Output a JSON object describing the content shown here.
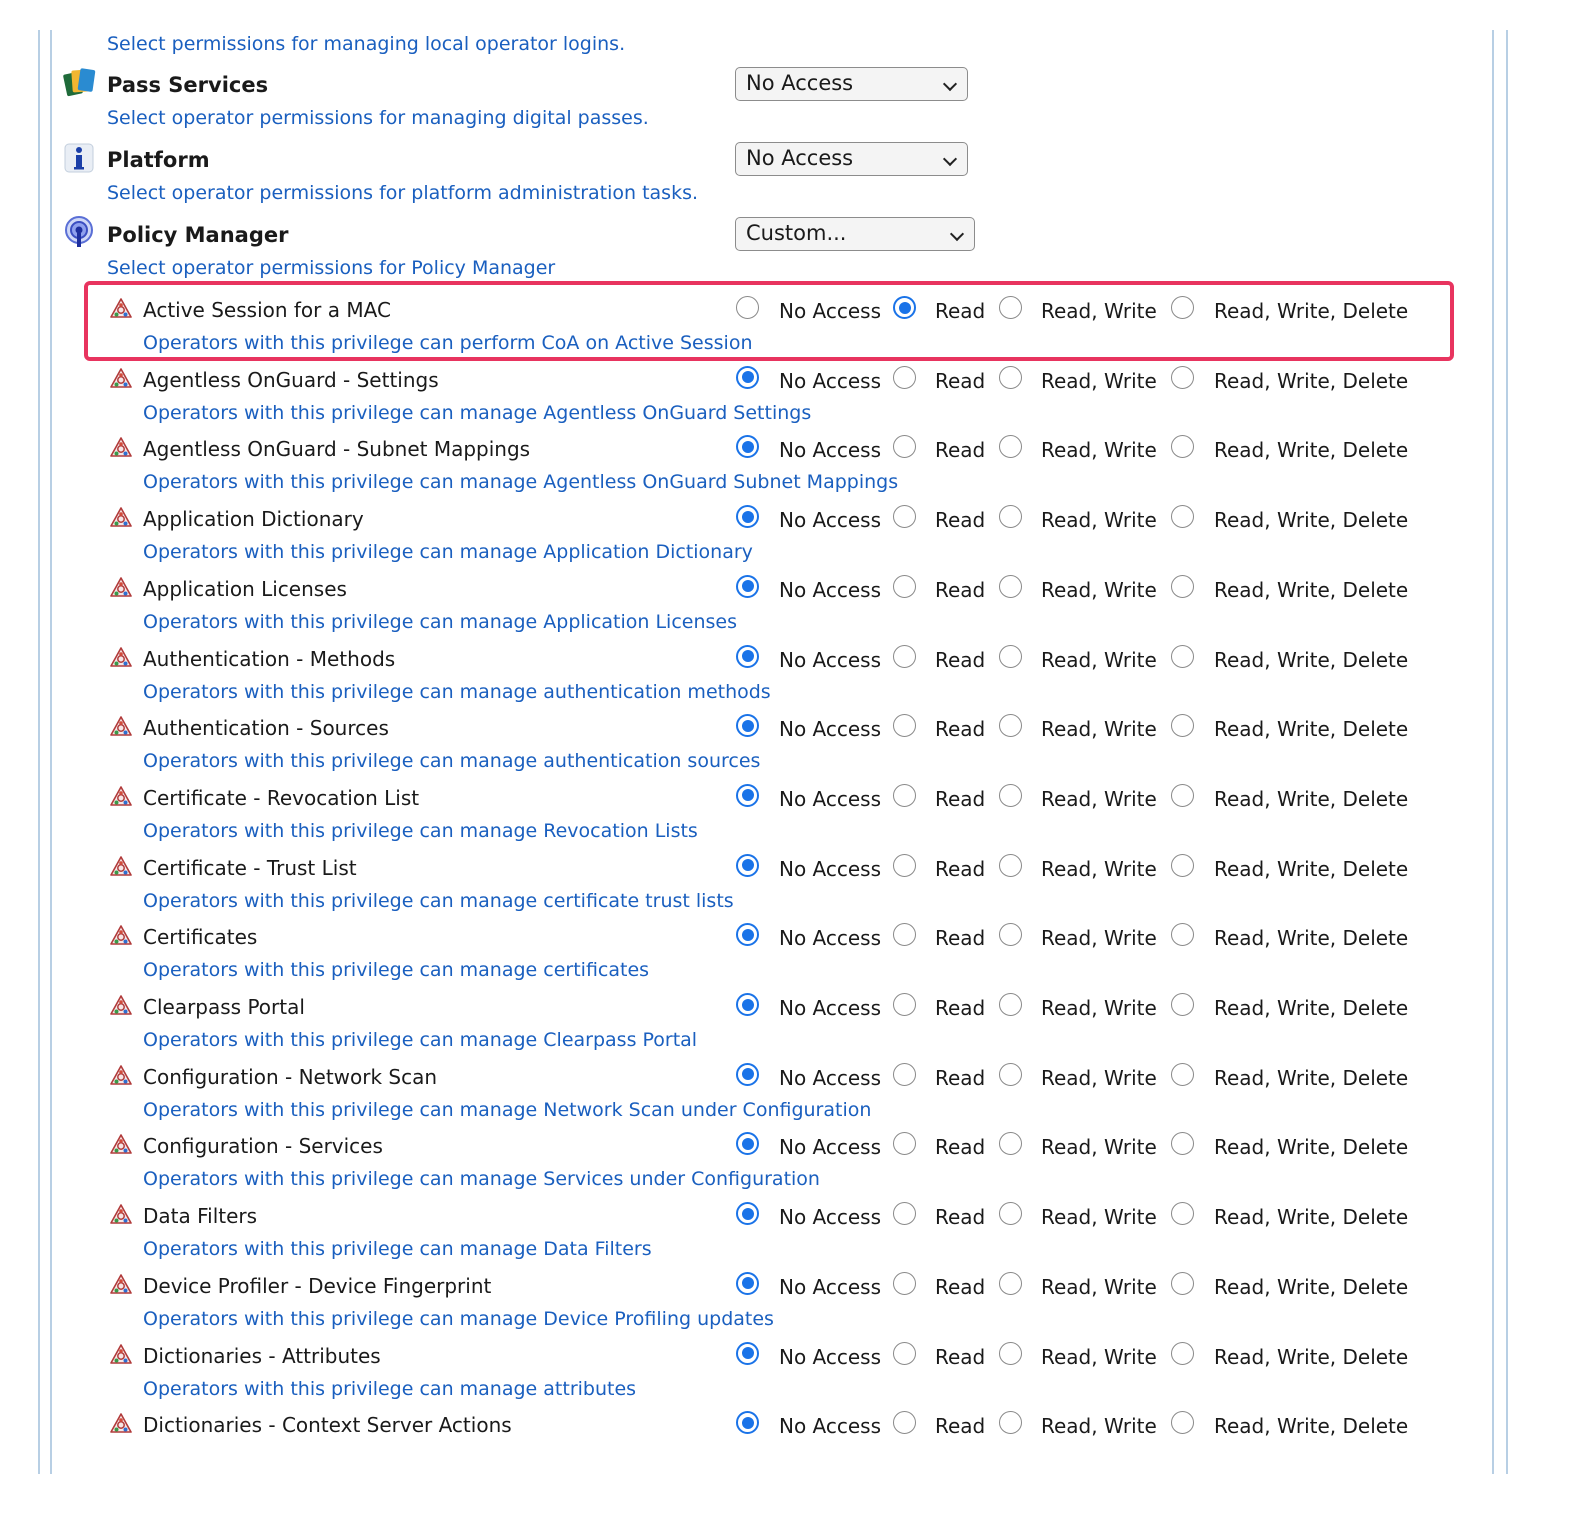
{
  "top_description": "Select permissions for managing local operator logins.",
  "categories": [
    {
      "title": "Pass Services",
      "description": "Select operator permissions for managing digital passes.",
      "selected": "No Access",
      "icon": "pass-cards-icon"
    },
    {
      "title": "Platform",
      "description": "Select operator permissions for platform administration tasks.",
      "selected": "No Access",
      "icon": "info-icon"
    },
    {
      "title": "Policy Manager",
      "description": "Select operator permissions for Policy Manager",
      "selected": "Custom...",
      "icon": "policy-manager-icon"
    }
  ],
  "option_labels": [
    "No Access",
    "Read",
    "Read, Write",
    "Read, Write, Delete"
  ],
  "permissions": [
    {
      "label": "Active Session for a MAC",
      "description": "Operators with this privilege can perform CoA on Active Session",
      "selected": "Read",
      "highlighted": true
    },
    {
      "label": "Agentless OnGuard - Settings",
      "description": "Operators with this privilege can manage Agentless OnGuard Settings",
      "selected": "No Access"
    },
    {
      "label": "Agentless OnGuard - Subnet Mappings",
      "description": "Operators with this privilege can manage Agentless OnGuard Subnet Mappings",
      "selected": "No Access"
    },
    {
      "label": "Application Dictionary",
      "description": "Operators with this privilege can manage Application Dictionary",
      "selected": "No Access"
    },
    {
      "label": "Application Licenses",
      "description": "Operators with this privilege can manage Application Licenses",
      "selected": "No Access"
    },
    {
      "label": "Authentication - Methods",
      "description": "Operators with this privilege can manage authentication methods",
      "selected": "No Access"
    },
    {
      "label": "Authentication - Sources",
      "description": "Operators with this privilege can manage authentication sources",
      "selected": "No Access"
    },
    {
      "label": "Certificate - Revocation List",
      "description": "Operators with this privilege can manage Revocation Lists",
      "selected": "No Access"
    },
    {
      "label": "Certificate - Trust List",
      "description": "Operators with this privilege can manage certificate trust lists",
      "selected": "No Access"
    },
    {
      "label": "Certificates",
      "description": "Operators with this privilege can manage certificates",
      "selected": "No Access"
    },
    {
      "label": "Clearpass Portal",
      "description": "Operators with this privilege can manage Clearpass Portal",
      "selected": "No Access"
    },
    {
      "label": "Configuration - Network Scan",
      "description": "Operators with this privilege can manage Network Scan under Configuration",
      "selected": "No Access"
    },
    {
      "label": "Configuration - Services",
      "description": "Operators with this privilege can manage Services under Configuration",
      "selected": "No Access"
    },
    {
      "label": "Data Filters",
      "description": "Operators with this privilege can manage Data Filters",
      "selected": "No Access"
    },
    {
      "label": "Device Profiler - Device Fingerprint",
      "description": "Operators with this privilege can manage Device Profiling updates",
      "selected": "No Access"
    },
    {
      "label": "Dictionaries - Attributes",
      "description": "Operators with this privilege can manage attributes",
      "selected": "No Access"
    },
    {
      "label": "Dictionaries - Context Server Actions",
      "description": "",
      "selected": "No Access"
    }
  ],
  "colors": {
    "link": "#1a5fbf",
    "radio_selected": "#1a73e8",
    "highlight_border": "#e8345f",
    "frame_line": "#b8cfe4"
  }
}
